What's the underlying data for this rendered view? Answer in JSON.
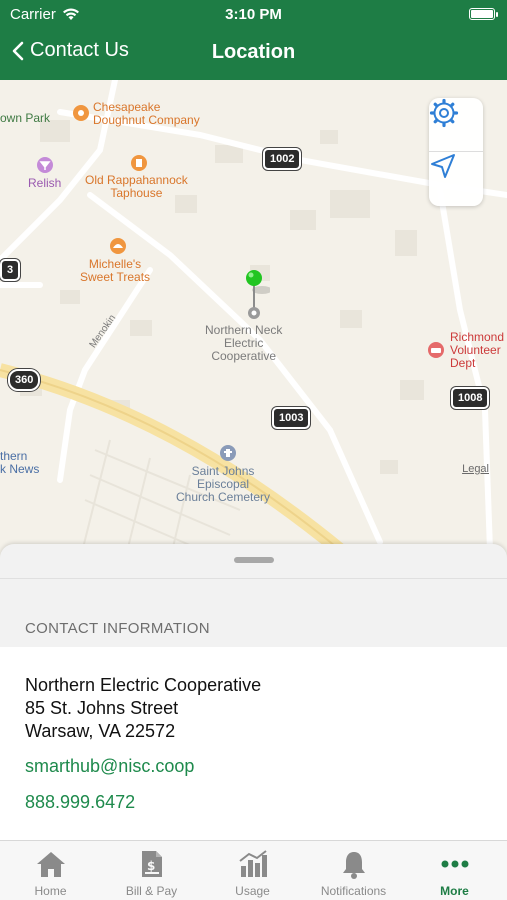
{
  "status_bar": {
    "carrier": "Carrier",
    "time": "3:10 PM"
  },
  "nav": {
    "back_label": "Contact Us",
    "title": "Location"
  },
  "map": {
    "pois": {
      "town_park": "own Park",
      "chesapeake_1": "Chesapeake",
      "chesapeake_2": "Doughnut Company",
      "relish": "Relish",
      "taphouse_1": "Old Rappahannock",
      "taphouse_2": "Taphouse",
      "michelles_1": "Michelle's",
      "michelles_2": "Sweet Treats",
      "menokin": "Menokin",
      "nnec_1": "Northern Neck",
      "nnec_2": "Electric",
      "nnec_3": "Cooperative",
      "richmond_1": "Richmond",
      "richmond_2": "Volunteer",
      "richmond_3": "Dept",
      "northern_news_1": "thern",
      "northern_news_2": "k News",
      "stjohns_1": "Saint Johns",
      "stjohns_2": "Episcopal",
      "stjohns_3": "Church Cemetery"
    },
    "shields": {
      "r1002": "1002",
      "r3": "3",
      "r360": "360",
      "r1003": "1003",
      "r1008": "1008"
    },
    "legal": "Legal",
    "controls": {
      "settings_icon": "gear-icon",
      "locate_icon": "location-arrow-icon"
    }
  },
  "contact": {
    "section_header": "CONTACT INFORMATION",
    "name": "Northern Electric Cooperative",
    "street": "85 St. Johns Street",
    "city": "Warsaw, VA 22572",
    "email": "smarthub@nisc.coop",
    "phone": "888.999.6472"
  },
  "tabs": [
    {
      "label": "Home",
      "icon": "house-icon"
    },
    {
      "label": "Bill & Pay",
      "icon": "bill-icon"
    },
    {
      "label": "Usage",
      "icon": "chart-icon"
    },
    {
      "label": "Notifications",
      "icon": "bell-icon"
    },
    {
      "label": "More",
      "icon": "more-dots-icon",
      "active": true
    }
  ],
  "colors": {
    "brand_green": "#1e7d45",
    "link_green": "#1e8a4c",
    "pin_green": "#22c521"
  }
}
